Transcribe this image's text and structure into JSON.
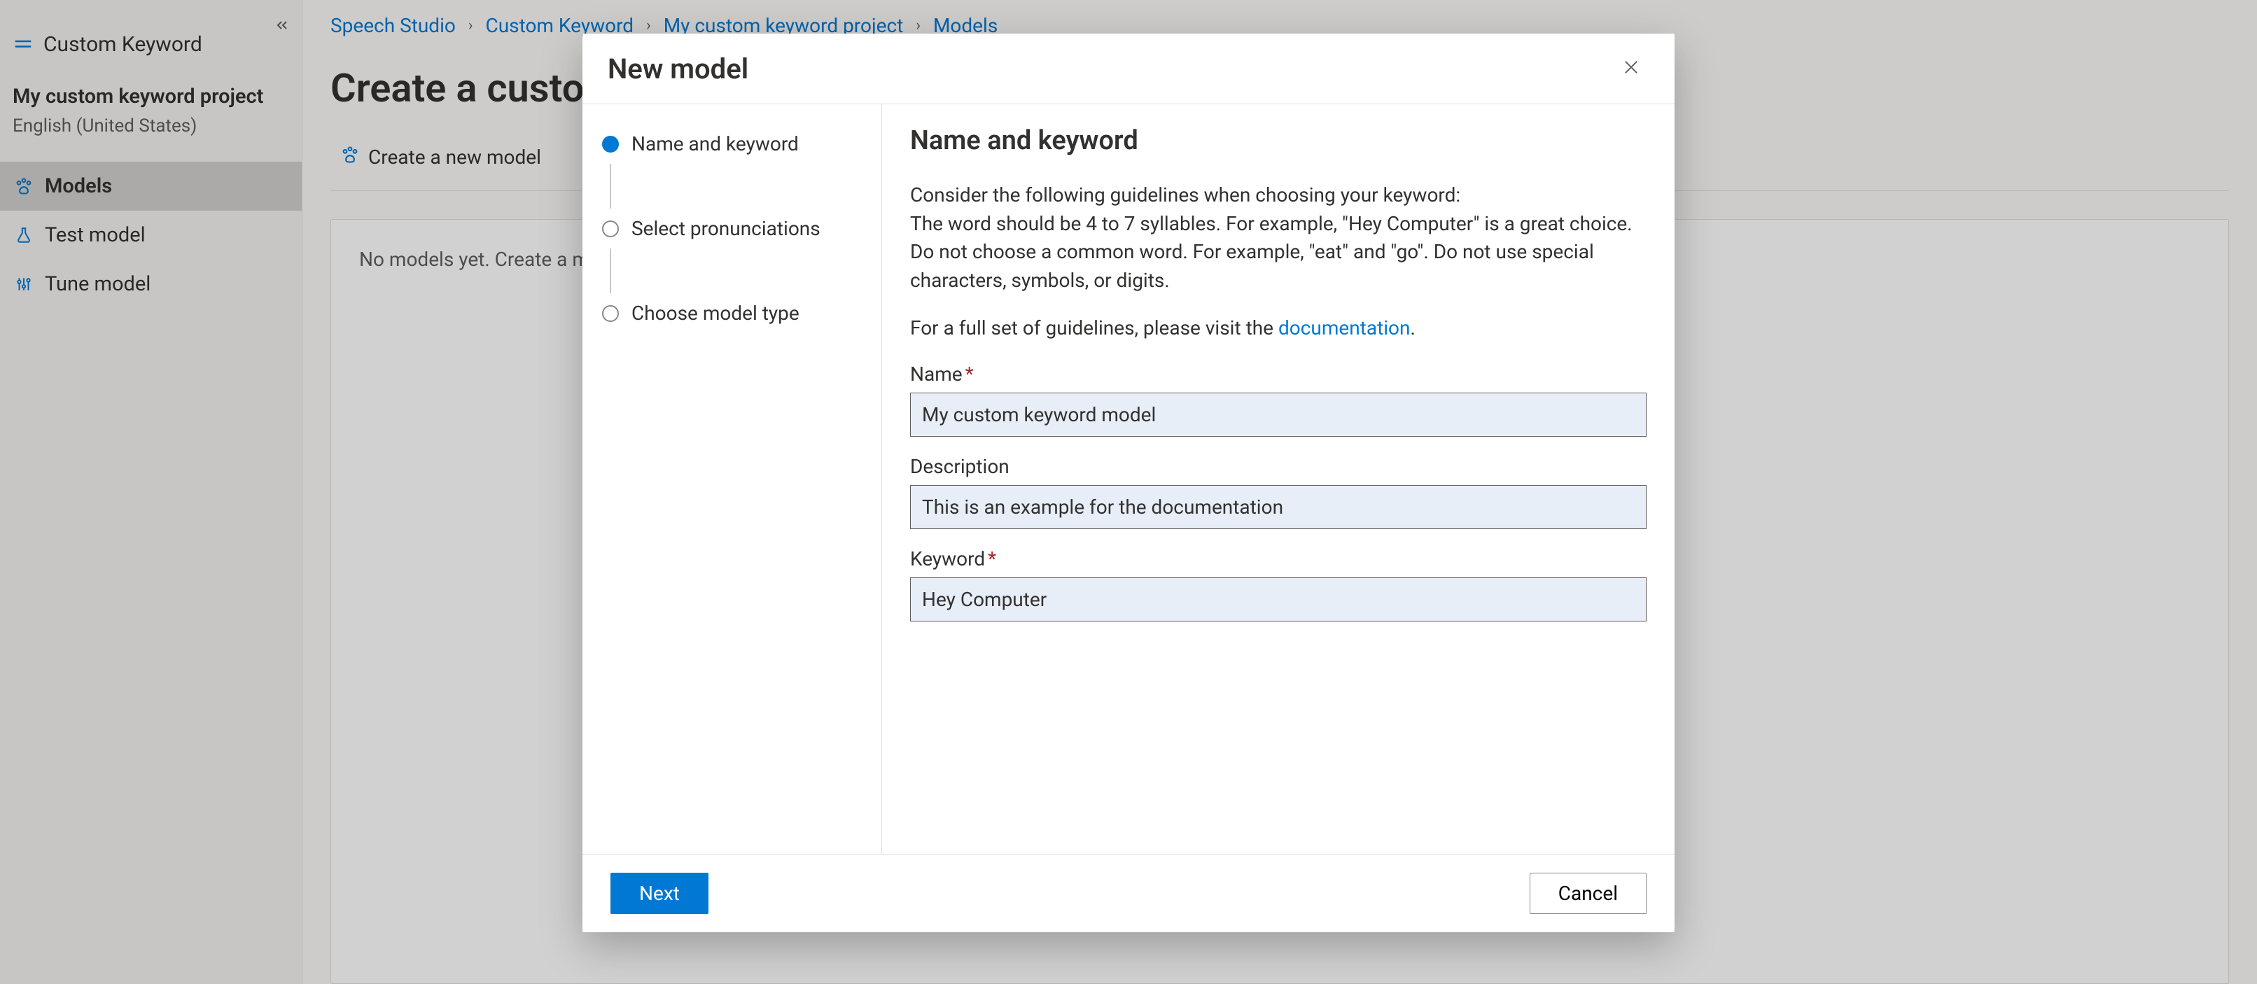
{
  "sidebar": {
    "collapse_tooltip": "Collapse",
    "header_label": "Custom Keyword",
    "project_name": "My custom keyword project",
    "project_lang": "English (United States)",
    "nav": [
      {
        "label": "Models",
        "icon": "paw"
      },
      {
        "label": "Test model",
        "icon": "flask"
      },
      {
        "label": "Tune model",
        "icon": "tune"
      }
    ]
  },
  "breadcrumb": [
    "Speech Studio",
    "Custom Keyword",
    "My custom keyword project",
    "Models"
  ],
  "page_title": "Create a custom keyword model",
  "toolbar": {
    "create_label": "Create a new model"
  },
  "content_well_hint": "No models yet. Create a model to get started with custom keywords, and …",
  "modal": {
    "title": "New model",
    "steps": [
      "Name and keyword",
      "Select pronunciations",
      "Choose model type"
    ],
    "active_step": 0,
    "content": {
      "heading": "Name and keyword",
      "guidelines_intro": "Consider the following guidelines when choosing your keyword:",
      "guidelines_body": "The word should be 4 to 7 syllables. For example, \"Hey Computer\" is a great choice. Do not choose a common word. For example, \"eat\" and \"go\". Do not use special characters, symbols, or digits.",
      "doc_sentence_prefix": "For a full set of guidelines, please visit the ",
      "doc_link_text": "documentation",
      "doc_sentence_suffix": ".",
      "fields": {
        "name": {
          "label": "Name",
          "required": true,
          "value": "My custom keyword model"
        },
        "description": {
          "label": "Description",
          "required": false,
          "value": "This is an example for the documentation"
        },
        "keyword": {
          "label": "Keyword",
          "required": true,
          "value": "Hey Computer"
        }
      }
    },
    "footer": {
      "next": "Next",
      "cancel": "Cancel"
    }
  }
}
